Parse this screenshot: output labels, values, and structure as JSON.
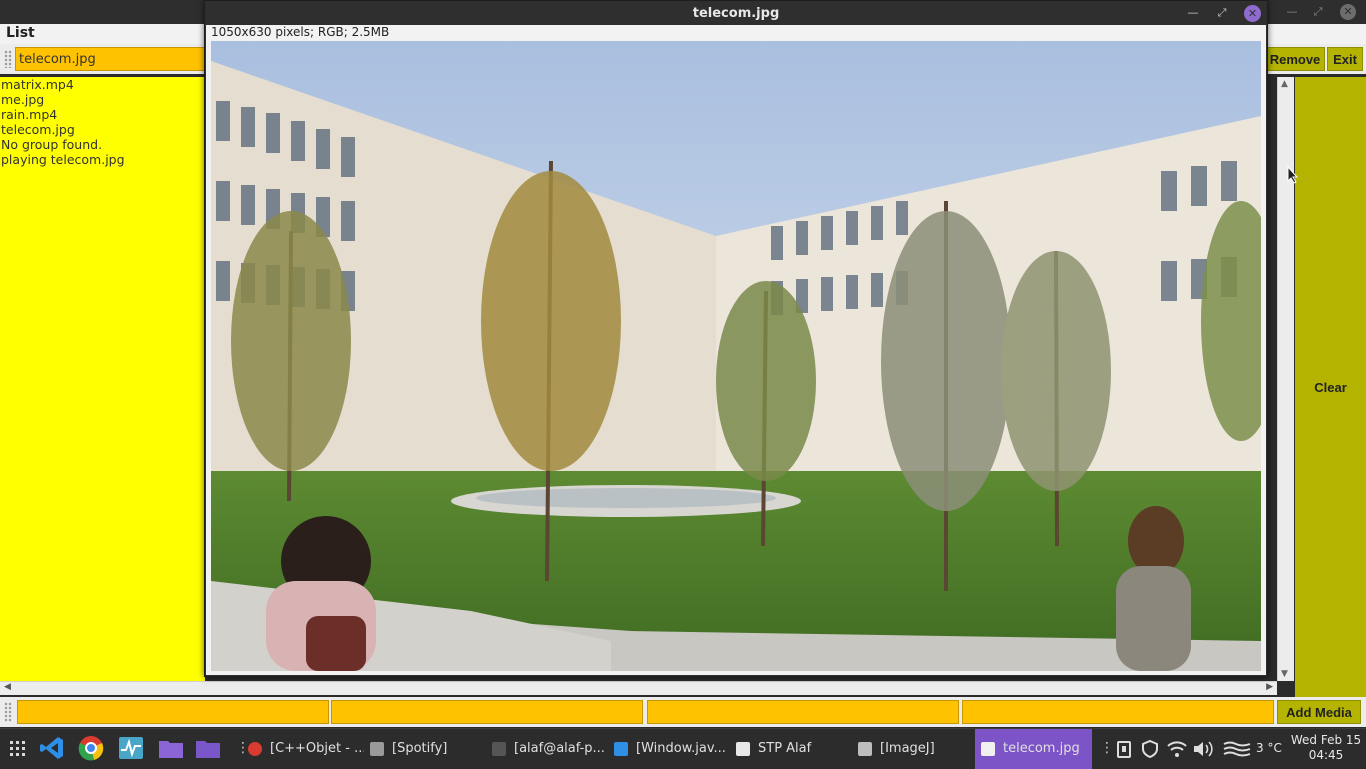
{
  "background_app": {
    "menu": {
      "list_label": "List"
    },
    "file_field_value": "telecom.jpg",
    "remove_label": "Remove",
    "exit_label": "Exit",
    "clear_label": "Clear",
    "add_media_label": "Add Media",
    "list_items": [
      "matrix.mp4",
      "me.jpg",
      "rain.mp4",
      "telecom.jpg",
      "No group found.",
      "playing telecom.jpg"
    ],
    "status_fields": [
      "",
      "",
      "",
      ""
    ],
    "colors": {
      "list_bg": "#ffff00",
      "field_bg": "#ffc200",
      "button_bg": "#b3b300"
    }
  },
  "viewer": {
    "title": "telecom.jpg",
    "info": "1050x630 pixels; RGB; 2.5MB",
    "close_color": "#8f6bd0"
  },
  "taskbar": {
    "tasks": [
      {
        "label": "[C++Objet - ...",
        "icon": "chrome-icon"
      },
      {
        "label": "[Spotify]",
        "icon": "window-icon"
      },
      {
        "label": "[alaf@alaf-p...",
        "icon": "terminal-icon"
      },
      {
        "label": "[Window.jav...",
        "icon": "vscode-icon"
      },
      {
        "label": "STP Alaf",
        "icon": "java-icon"
      },
      {
        "label": "[ImageJ]",
        "icon": "java-icon"
      },
      {
        "label": "telecom.jpg",
        "icon": "java-icon"
      }
    ],
    "temperature": "3 °C",
    "clock_date": "Wed Feb 15",
    "clock_time": "04:45",
    "active_color": "#7c54c7"
  }
}
